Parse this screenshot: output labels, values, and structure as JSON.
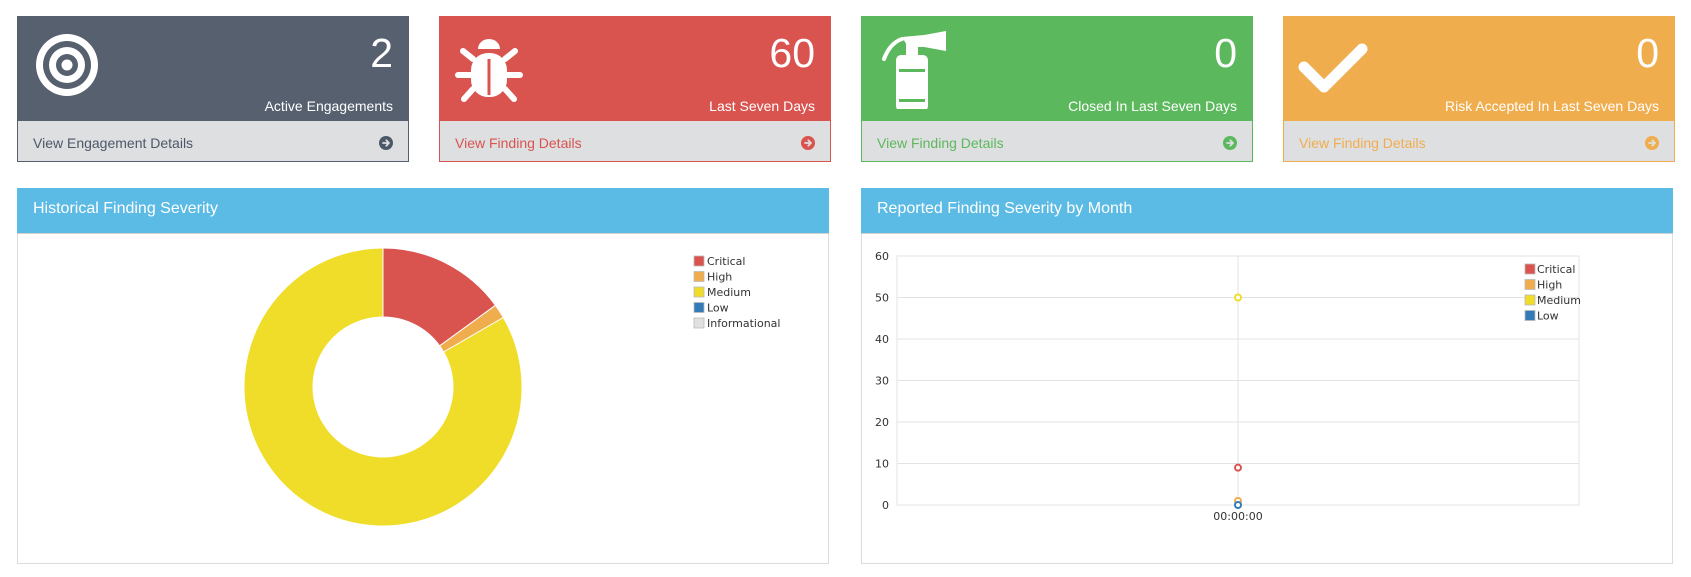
{
  "cards": [
    {
      "value": "2",
      "caption": "Active Engagements",
      "link": "View Engagement Details",
      "icon": "target-icon",
      "color": "#56606e",
      "link_color": "#4c5868"
    },
    {
      "value": "60",
      "caption": "Last Seven Days",
      "link": "View Finding Details",
      "icon": "bug-icon",
      "color": "#d9534f",
      "link_color": "#d9534f"
    },
    {
      "value": "0",
      "caption": "Closed In Last Seven Days",
      "link": "View Finding Details",
      "icon": "fire-extinguisher-icon",
      "color": "#5cb85c",
      "link_color": "#5cb85c"
    },
    {
      "value": "0",
      "caption": "Risk Accepted In Last Seven Days",
      "link": "View Finding Details",
      "icon": "checkmark-icon",
      "color": "#f0ad4e",
      "link_color": "#f0ad4e"
    }
  ],
  "panels": {
    "left_title": "Historical Finding Severity",
    "right_title": "Reported Finding Severity by Month"
  },
  "chart_data": [
    {
      "type": "pie",
      "categories": [
        "Critical",
        "High",
        "Medium",
        "Low",
        "Informational"
      ],
      "values": [
        9,
        1,
        50,
        0,
        0
      ],
      "colors": [
        "#d9534f",
        "#f0ad4e",
        "#efdd2a",
        "#337ab7",
        "#e0e0e0"
      ],
      "legend": [
        "Critical",
        "High",
        "Medium",
        "Low",
        "Informational"
      ],
      "legend_position": "top-right",
      "donut": true
    },
    {
      "type": "scatter",
      "x": [
        "00:00:00"
      ],
      "series": [
        {
          "name": "Critical",
          "values": [
            9
          ],
          "color": "#d9534f"
        },
        {
          "name": "High",
          "values": [
            1
          ],
          "color": "#f0ad4e"
        },
        {
          "name": "Medium",
          "values": [
            50
          ],
          "color": "#efdd2a"
        },
        {
          "name": "Low",
          "values": [
            0
          ],
          "color": "#337ab7"
        }
      ],
      "yticks": [
        0,
        10,
        20,
        30,
        40,
        50,
        60
      ],
      "ylim": [
        0,
        60
      ],
      "grid": true,
      "legend_position": "top-right"
    }
  ]
}
